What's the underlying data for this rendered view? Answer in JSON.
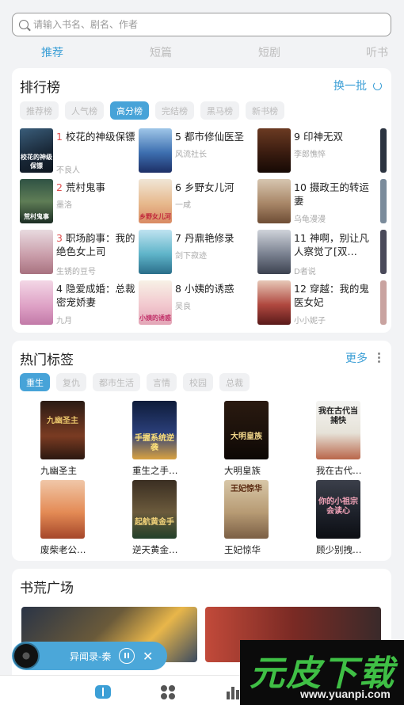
{
  "search": {
    "placeholder": "请输入书名、剧名、作者"
  },
  "tabs": [
    "推荐",
    "短篇",
    "短剧",
    "听书"
  ],
  "ranking": {
    "title": "排行榜",
    "refresh_label": "换一批",
    "filters": [
      "推荐榜",
      "人气榜",
      "高分榜",
      "完结榜",
      "黑马榜",
      "新书榜"
    ],
    "items": [
      {
        "num": "1",
        "title": "校花的神级保镖",
        "author": "不良人",
        "cover_text": "校花的神级保镖"
      },
      {
        "num": "2",
        "title": "荒村鬼事",
        "author": "墨洛",
        "cover_text": "荒村鬼事"
      },
      {
        "num": "3",
        "title": "职场韵事：我的绝色女上司",
        "author": "生锈的豆号",
        "cover_text": ""
      },
      {
        "num": "4",
        "title": "隐爱成婚：总裁密宠娇妻",
        "author": "九月",
        "cover_text": ""
      },
      {
        "num": "5",
        "title": "都市修仙医圣",
        "author": "风流社长",
        "cover_text": ""
      },
      {
        "num": "6",
        "title": "乡野女儿河",
        "author": "一咸",
        "cover_text": "乡野女儿河"
      },
      {
        "num": "7",
        "title": "丹鼎艳修录",
        "author": "剑下寂迹",
        "cover_text": ""
      },
      {
        "num": "8",
        "title": "小姨的诱惑",
        "author": "吴良",
        "cover_text": "小姨的诱惑"
      },
      {
        "num": "9",
        "title": "印神无双",
        "author": "李郎憔悴",
        "cover_text": ""
      },
      {
        "num": "10",
        "title": "摄政王的转运妻",
        "author": "乌龟漫漫",
        "cover_text": ""
      },
      {
        "num": "11",
        "title": "神啊，别让凡人察觉了[双…",
        "author": "D者说",
        "cover_text": ""
      },
      {
        "num": "12",
        "title": "穿越：我的鬼医女妃",
        "author": "小小妮子",
        "cover_text": ""
      }
    ]
  },
  "hot_tags": {
    "title": "热门标签",
    "more_label": "更多",
    "tags": [
      "重生",
      "复仇",
      "都市生活",
      "言情",
      "校园",
      "总裁"
    ],
    "books": [
      {
        "title": "九幽圣主",
        "cover_text": "九幽圣主"
      },
      {
        "title": "重生之手…",
        "cover_text": "手握系统逆袭"
      },
      {
        "title": "大明皇族",
        "cover_text": "大明皇族"
      },
      {
        "title": "我在古代…",
        "cover_text": "我在古代当捕快"
      },
      {
        "title": "废柴老公…",
        "cover_text": ""
      },
      {
        "title": "逆天黄金…",
        "cover_text": "起航黄金手"
      },
      {
        "title": "王妃惊华",
        "cover_text": "王妃惊华"
      },
      {
        "title": "顾少别拽…",
        "cover_text": "你的小祖宗会读心"
      }
    ]
  },
  "plaza": {
    "title": "书荒广场"
  },
  "player": {
    "title": "异闻录-秦"
  },
  "watermark": {
    "main": "元皮下载",
    "url": "www.yuanpi.com"
  },
  "colors": {
    "accent": "#3c9fd6",
    "rank_number": "#e05151",
    "watermark_green": "#3fbf45"
  }
}
